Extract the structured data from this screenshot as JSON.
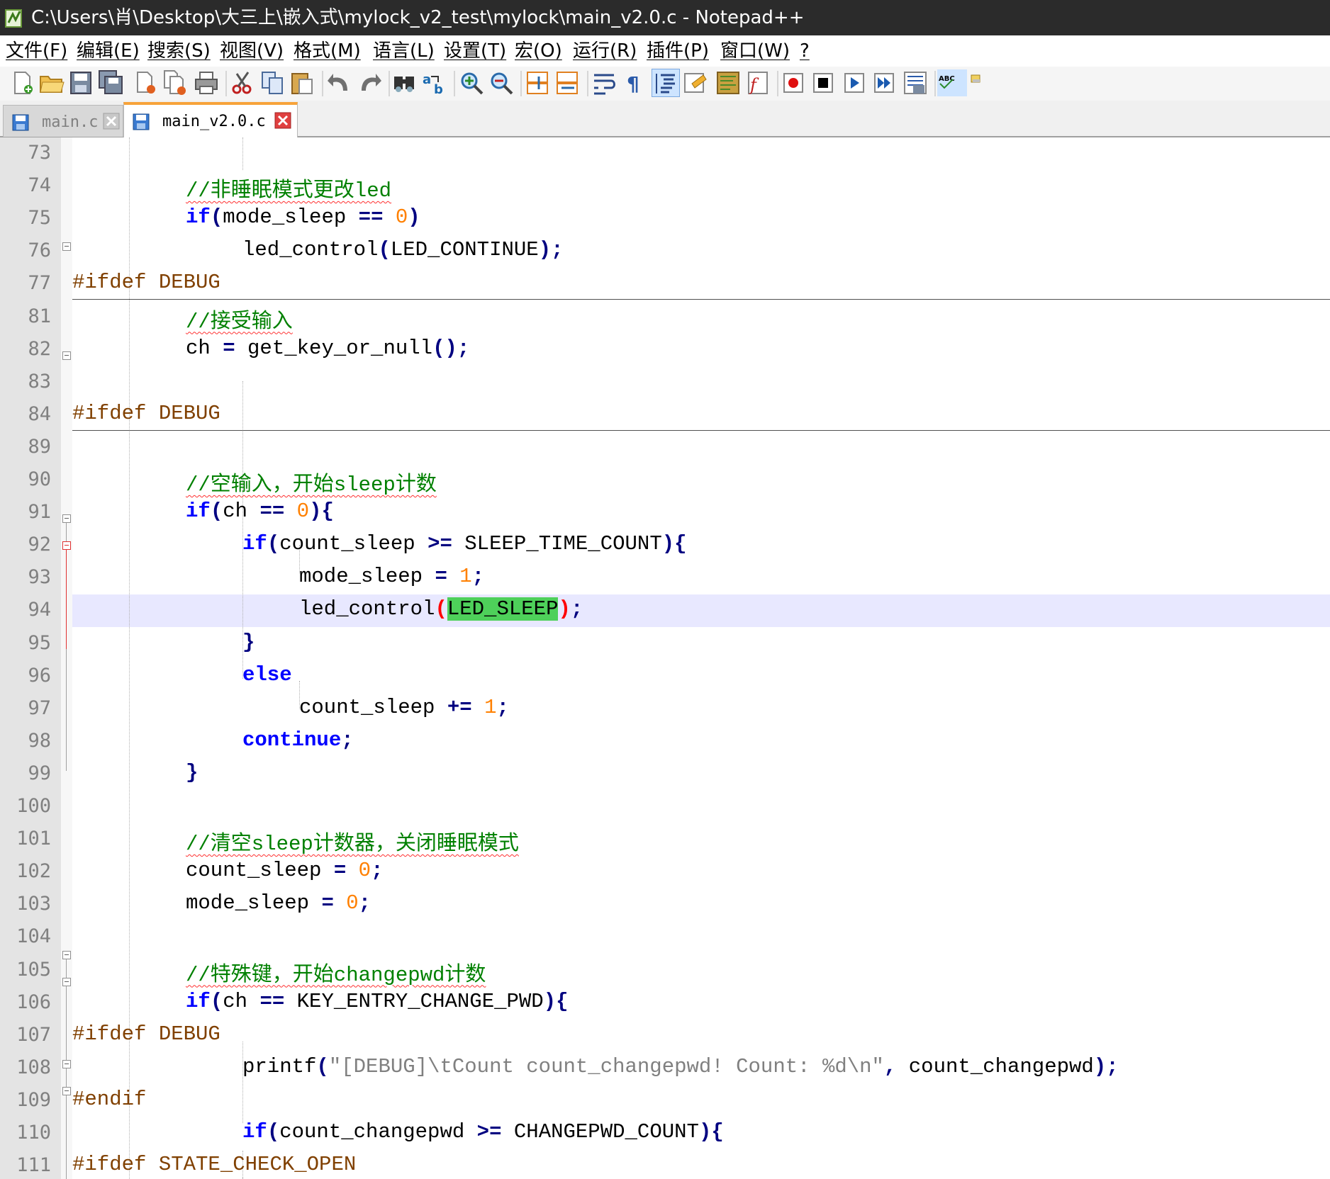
{
  "window": {
    "title": "C:\\Users\\肖\\Desktop\\大三上\\嵌入式\\mylock_v2_test\\mylock\\main_v2.0.c - Notepad++"
  },
  "menu": {
    "items": [
      "文件(F)",
      "编辑(E)",
      "搜索(S)",
      "视图(V)",
      "格式(M)",
      "语言(L)",
      "设置(T)",
      "宏(O)",
      "运行(R)",
      "插件(P)",
      "窗口(W)",
      "?"
    ]
  },
  "toolbar": {
    "buttons": [
      "new-file-icon",
      "open-file-icon",
      "save-icon",
      "save-all-icon",
      "close-icon",
      "close-all-icon",
      "print-icon",
      "cut-icon",
      "copy-icon",
      "paste-icon",
      "undo-icon",
      "redo-icon",
      "find-icon",
      "replace-icon",
      "zoom-in-icon",
      "zoom-out-icon",
      "sync-vertical-icon",
      "sync-horizontal-icon",
      "word-wrap-icon",
      "show-all-chars-icon",
      "indent-guide-icon",
      "user-language-icon",
      "doc-map-icon",
      "function-list-icon",
      "record-macro-icon",
      "stop-record-icon",
      "play-macro-icon",
      "run-macro-multiple-icon",
      "save-macro-icon",
      "spell-check-icon",
      "misc-icon"
    ]
  },
  "tabs": [
    {
      "label": "main.c",
      "active": false
    },
    {
      "label": "main_v2.0.c",
      "active": true
    }
  ],
  "editor": {
    "lines": [
      {
        "num": "73",
        "code": ""
      },
      {
        "num": "74",
        "code": "//非睡眠模式更改led"
      },
      {
        "num": "75",
        "code": "if(mode_sleep == 0)"
      },
      {
        "num": "76",
        "code": "led_control(LED_CONTINUE);"
      },
      {
        "num": "77",
        "code": "#ifdef DEBUG"
      },
      {
        "num": "81",
        "code": "//接受输入"
      },
      {
        "num": "82",
        "code": "ch = get_key_or_null();"
      },
      {
        "num": "83",
        "code": ""
      },
      {
        "num": "84",
        "code": "#ifdef DEBUG"
      },
      {
        "num": "89",
        "code": ""
      },
      {
        "num": "90",
        "code": "//空输入，开始sleep计数"
      },
      {
        "num": "91",
        "code": "if(ch == 0){"
      },
      {
        "num": "92",
        "code": "if(count_sleep >= SLEEP_TIME_COUNT){"
      },
      {
        "num": "93",
        "code": "mode_sleep = 1;"
      },
      {
        "num": "94",
        "code": "led_control(LED_SLEEP);"
      },
      {
        "num": "95",
        "code": "}"
      },
      {
        "num": "96",
        "code": "else"
      },
      {
        "num": "97",
        "code": "count_sleep += 1;"
      },
      {
        "num": "98",
        "code": "continue;"
      },
      {
        "num": "99",
        "code": "}"
      },
      {
        "num": "100",
        "code": ""
      },
      {
        "num": "101",
        "code": "//清空sleep计数器，关闭睡眠模式"
      },
      {
        "num": "102",
        "code": "count_sleep = 0;"
      },
      {
        "num": "103",
        "code": "mode_sleep = 0;"
      },
      {
        "num": "104",
        "code": ""
      },
      {
        "num": "105",
        "code": "//特殊键，开始changepwd计数"
      },
      {
        "num": "106",
        "code": "if(ch == KEY_ENTRY_CHANGE_PWD){"
      },
      {
        "num": "107",
        "code": "#ifdef DEBUG"
      },
      {
        "num": "108",
        "code": "printf(\"[DEBUG]\\tCount count_changepwd! Count: %d\\n\", count_changepwd);"
      },
      {
        "num": "109",
        "code": "#endif"
      },
      {
        "num": "110",
        "code": "if(count_changepwd >= CHANGEPWD_COUNT){"
      },
      {
        "num": "111",
        "code": "#ifdef STATE_CHECK_OPEN"
      }
    ],
    "current_line": "94",
    "colors": {
      "keyword": "#0000ff",
      "comment": "#008000",
      "number": "#ff8000",
      "operator": "#000080",
      "preprocessor": "#804000",
      "string": "#808080",
      "brace_match_bg": "#4ed05a",
      "current_line_bg": "#e8e8ff"
    }
  }
}
